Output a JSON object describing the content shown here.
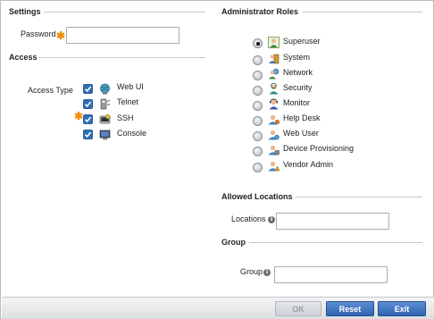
{
  "settings": {
    "title": "Settings",
    "password_label": "Password",
    "password_value": ""
  },
  "access": {
    "title": "Access",
    "access_type_label": "Access Type",
    "items": [
      {
        "label": "Web UI",
        "checked": true,
        "icon": "web-ui-icon",
        "required": false
      },
      {
        "label": "Telnet",
        "checked": true,
        "icon": "telnet-icon",
        "required": true
      },
      {
        "label": "SSH",
        "checked": true,
        "icon": "ssh-icon",
        "required": false
      },
      {
        "label": "Console",
        "checked": true,
        "icon": "console-icon",
        "required": false
      }
    ]
  },
  "roles": {
    "title": "Administrator Roles",
    "selected": "Superuser",
    "items": [
      {
        "label": "Superuser",
        "icon": "superuser-icon"
      },
      {
        "label": "System",
        "icon": "system-icon"
      },
      {
        "label": "Network",
        "icon": "network-icon"
      },
      {
        "label": "Security",
        "icon": "security-icon"
      },
      {
        "label": "Monitor",
        "icon": "monitor-icon"
      },
      {
        "label": "Help Desk",
        "icon": "help-desk-icon"
      },
      {
        "label": "Web User",
        "icon": "web-user-icon"
      },
      {
        "label": "Device Provisioning",
        "icon": "device-provisioning-icon"
      },
      {
        "label": "Vendor Admin",
        "icon": "vendor-admin-icon"
      }
    ]
  },
  "locations": {
    "title": "Allowed Locations",
    "label": "Locations",
    "value": ""
  },
  "group": {
    "title": "Group",
    "label": "Group",
    "value": ""
  },
  "footer": {
    "ok_label": "OK",
    "reset_label": "Reset",
    "exit_label": "Exit"
  },
  "colors": {
    "accent": "#2f63b0",
    "required": "#f28c00",
    "checkbox": "#2f6fb6"
  }
}
